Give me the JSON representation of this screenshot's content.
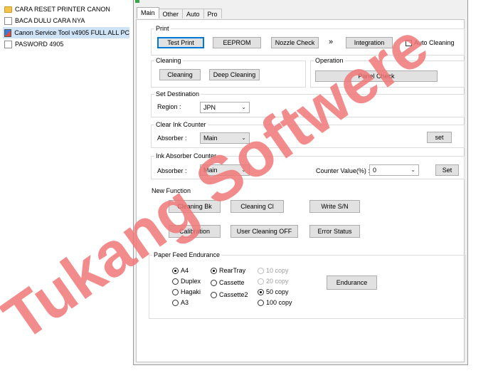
{
  "explorer": {
    "items": [
      {
        "label": "CARA RESET PRINTER CANON",
        "icon": "folder-icon"
      },
      {
        "label": "BACA DULU CARA NYA",
        "icon": "text-document-icon"
      },
      {
        "label": "Canon Service Tool v4905 FULL ALL PC",
        "icon": "application-icon",
        "selected": true
      },
      {
        "label": "PASWORD 4905",
        "icon": "text-document-icon"
      }
    ]
  },
  "tabs": [
    "Main",
    "Other",
    "Auto",
    "Pro"
  ],
  "active_tab": "Main",
  "print": {
    "legend": "Print",
    "test_print": "Test Print",
    "eeprom": "EEPROM",
    "nozzle_check": "Nozzle Check",
    "arrows": "»",
    "integration": "Integration",
    "auto_cleaning": "Auto Cleaning",
    "auto_cleaning_checked": false
  },
  "cleaning": {
    "legend": "Cleaning",
    "cleaning": "Cleaning",
    "deep_cleaning": "Deep Cleaning"
  },
  "operation": {
    "legend": "Operation",
    "panel_check": "Panel Check"
  },
  "set_destination": {
    "legend": "Set Destination",
    "region_label": "Region :",
    "region_value": "JPN"
  },
  "clear_ink_counter": {
    "legend": "Clear Ink Counter",
    "absorber_label": "Absorber :",
    "absorber_value": "Main",
    "set": "set"
  },
  "ink_absorber_counter": {
    "legend": "Ink Absorber Counter",
    "absorber_label": "Absorber :",
    "absorber_value": "Main",
    "counter_label": "Counter Value(%) :",
    "counter_value": "0",
    "set": "Set"
  },
  "new_function": {
    "legend": "New Function",
    "cleaning_bk": "Cleaning Bk",
    "cleaning_cl": "Cleaning Cl",
    "write_sn": "Write S/N",
    "calibration": "Calibration",
    "user_cleaning_off": "User Cleaning OFF",
    "error_status": "Error Status"
  },
  "paper_feed": {
    "legend": "Paper Feed Endurance",
    "sizes": [
      {
        "label": "A4",
        "on": true
      },
      {
        "label": "Duplex",
        "on": false
      },
      {
        "label": "Hagaki",
        "on": false
      },
      {
        "label": "A3",
        "on": false
      }
    ],
    "trays": [
      {
        "label": "RearTray",
        "on": true
      },
      {
        "label": "Cassette",
        "on": false
      },
      {
        "label": "Cassette2",
        "on": false
      }
    ],
    "copies": [
      {
        "label": "10 copy",
        "on": false,
        "disabled": true
      },
      {
        "label": "20 copy",
        "on": false,
        "disabled": true
      },
      {
        "label": "50 copy",
        "on": true,
        "disabled": false
      },
      {
        "label": "100 copy",
        "on": false,
        "disabled": false
      }
    ],
    "endurance": "Endurance"
  },
  "watermark": {
    "text": "Tukang Softwere",
    "color": "#f07878"
  }
}
